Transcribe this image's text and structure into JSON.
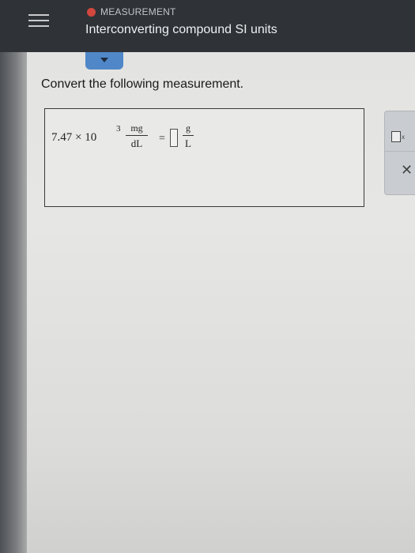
{
  "header": {
    "topic": "MEASUREMENT",
    "title": "Interconverting compound SI units",
    "topic_dot_color": "#d2473e"
  },
  "question": {
    "instruction": "Convert the following measurement.",
    "coefficient": "7.47 × 10",
    "exponent": "3",
    "given_unit_numerator": "mg",
    "given_unit_denominator": "dL",
    "equals_sign": "=",
    "answer_value": "",
    "target_unit_numerator": "g",
    "target_unit_denominator": "L"
  },
  "side_panel": {
    "units_button_icon": "fraction-units-icon",
    "units_button_subscript": "x",
    "clear_button_label": "✕"
  },
  "colors": {
    "header_bg": "#2f3236",
    "accent_blue": "#4f87c8"
  }
}
